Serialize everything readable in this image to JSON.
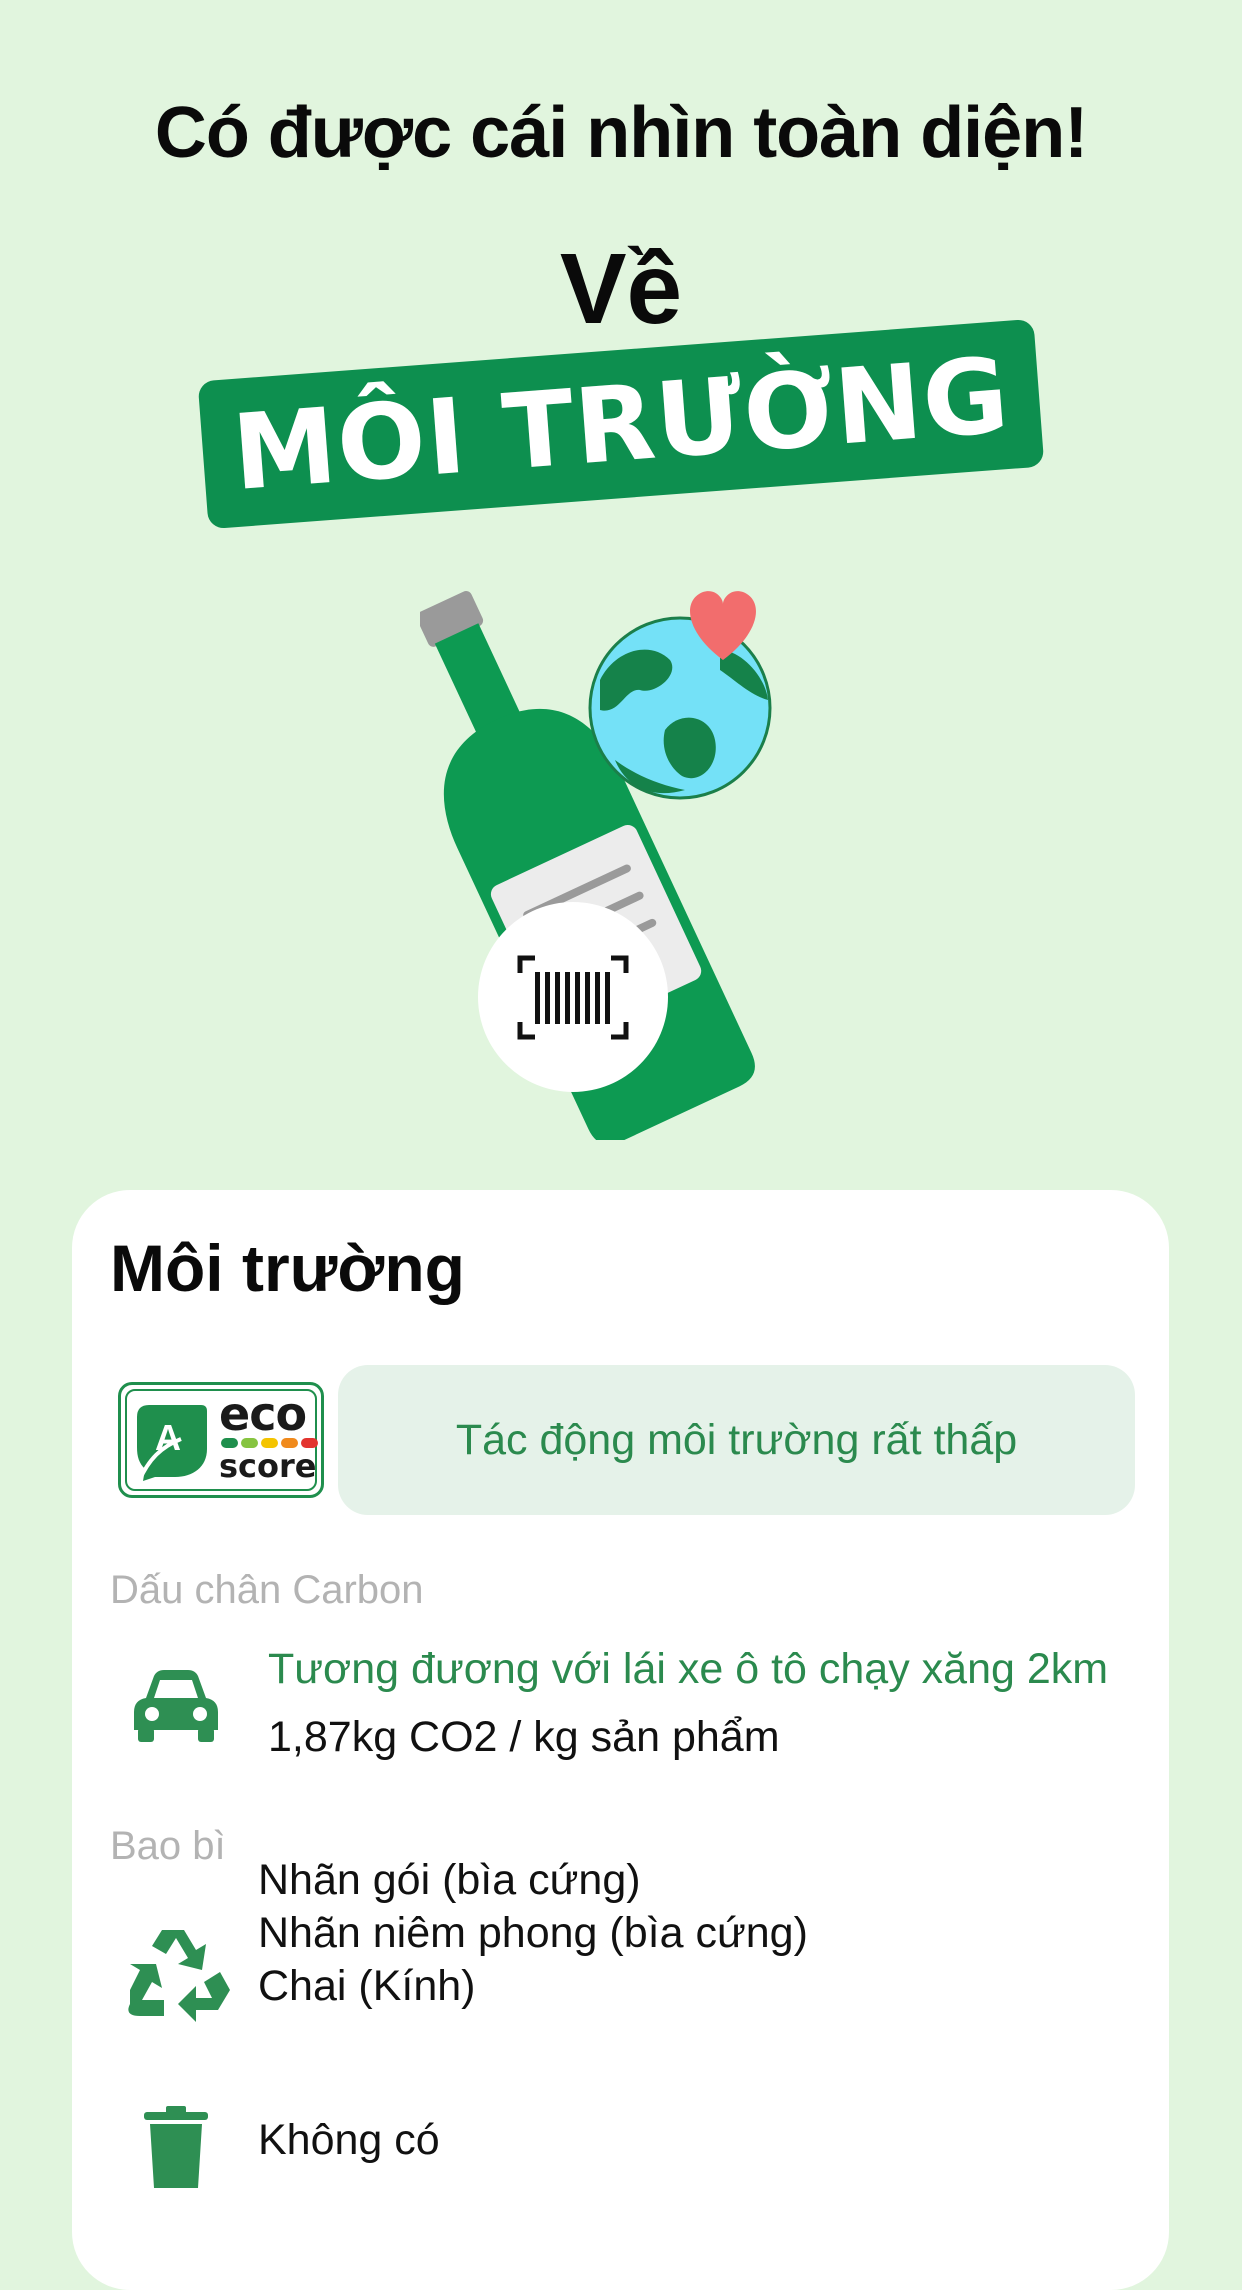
{
  "hero": {
    "headline": "Có được cái nhìn toàn diện!",
    "subhead": "Về",
    "banner": "MÔI TRƯỜNG"
  },
  "colors": {
    "background": "#e1f5de",
    "brand_green": "#0d8f4f",
    "text_green": "#2b8a4e",
    "heart": "#f26d6d",
    "globe_water": "#74e1f7"
  },
  "icons": {
    "illustration": "bottle-globe-barcode-illustration",
    "eco": "ecoscore-badge-icon",
    "car": "car-icon",
    "recycle": "recycle-icon",
    "trash": "trash-icon"
  },
  "card": {
    "title": "Môi trường",
    "ecoscore": {
      "grade": "A",
      "word_eco": "eco",
      "word_score": "score",
      "impact": "Tác động môi trường rất thấp"
    },
    "carbon": {
      "label": "Dấu chân Carbon",
      "equivalent": "Tương đương với lái xe ô tô chạy xăng 2km",
      "value": "1,87kg CO2 / kg sản phẩm"
    },
    "packaging": {
      "label": "Bao bì",
      "items": [
        "Nhãn gói (bìa cứng)",
        "Nhãn niêm phong (bìa cứng)",
        "Chai (Kính)"
      ],
      "non_recyclable": "Không có"
    }
  }
}
